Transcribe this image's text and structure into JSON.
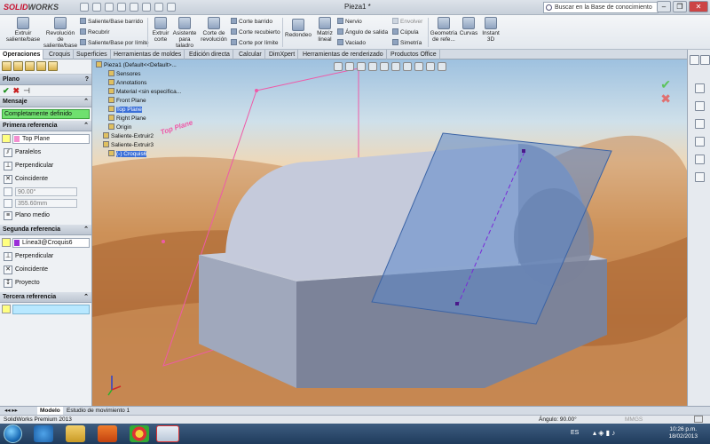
{
  "titlebar": {
    "app_logo_1": "SOLID",
    "app_logo_2": "WORKS",
    "document_title": "Pieza1 *",
    "search_placeholder": "Buscar en la Base de conocimiento"
  },
  "ribbon": {
    "extruir_saliente": "Extruir saliente/base",
    "revolucion_saliente": "Revolución de saliente/base",
    "saliente_barrido": "Saliente/Base barrido",
    "recubrir": "Recubrir",
    "saliente_limite": "Saliente/Base por límite",
    "extruir_corte": "Extruir corte",
    "asistente_taladro": "Asistente para taladro",
    "corte_revolucion": "Corte de revolución",
    "corte_barrido": "Corte barrido",
    "corte_recubierto": "Corte recubierto",
    "corte_limite": "Corte por límite",
    "redondeo": "Redondeo",
    "matriz_lineal": "Matriz lineal",
    "nervio": "Nervio",
    "angulo_salida": "Ángulo de salida",
    "vaciado": "Vaciado",
    "envolver": "Envolver",
    "cupula": "Cúpula",
    "simetria": "Simetría",
    "geometria_ref": "Geometría de refe...",
    "curvas": "Curvas",
    "instant3d": "Instant 3D"
  },
  "tabs": [
    "Operaciones",
    "Croquis",
    "Superficies",
    "Herramientas de moldes",
    "Edición directa",
    "Calcular",
    "DimXpert",
    "Herramientas de renderizado",
    "Productos Office"
  ],
  "panel": {
    "title": "Plano",
    "mensaje_header": "Mensaje",
    "status": "Completamente definido",
    "primera_header": "Primera referencia",
    "primera_value": "Top Plane",
    "paralelos": "Paralelos",
    "perpendicular": "Perpendicular",
    "coincidente": "Coincidente",
    "angle_value": "90.00°",
    "offset_value": "355.60mm",
    "plano_medio": "Plano medio",
    "segunda_header": "Segunda referencia",
    "segunda_value": "Línea3@Croquis6",
    "perpendicular2": "Perpendicular",
    "coincidente2": "Coincidente",
    "proyecto": "Proyecto",
    "tercera_header": "Tercera referencia"
  },
  "tree": {
    "root": "Pieza1  (Default<<Default>...",
    "items": [
      "Sensores",
      "Annotations",
      "Material <sin especifica...",
      "Front Plane",
      "Top Plane",
      "Right Plane",
      "Origin",
      "Saliente-Extruir2",
      "Saliente-Extruir3",
      "(-) Croquis6"
    ]
  },
  "viewport": {
    "plane_label": "Top Plane"
  },
  "bottom_tabs": [
    "Modelo",
    "Estudio de movimiento 1"
  ],
  "statusbar": {
    "left": "SolidWorks Premium 2013",
    "angle": "Ángulo: 90.00°",
    "mmgs": "MMGS"
  },
  "taskbar": {
    "lang": "ES",
    "time": "10:26 p.m.",
    "date": "18/02/2013"
  }
}
